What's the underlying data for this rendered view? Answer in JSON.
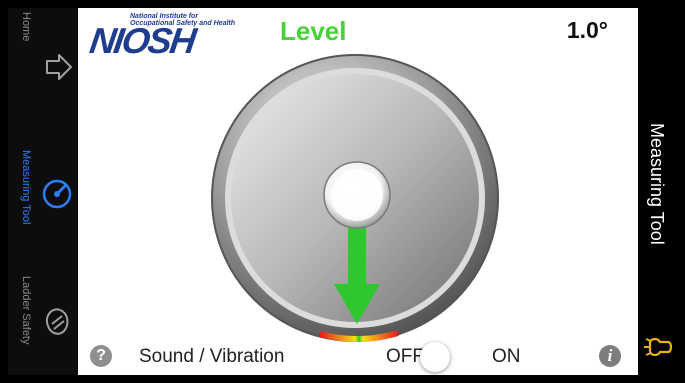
{
  "tabs": [
    {
      "label": "Home",
      "icon": "home-arrow-icon",
      "active": false
    },
    {
      "label": "Measuring Tool",
      "icon": "gauge-icon",
      "active": true
    },
    {
      "label": "Ladder Safety",
      "icon": "ladder-safety-icon",
      "active": false
    }
  ],
  "header": {
    "logo_text": "NIOSH",
    "logo_tagline": "National Institute for Occupational Safety and Health",
    "title": "Level",
    "angle": "1.0°"
  },
  "bottom": {
    "help_icon": "?",
    "sound_label": "Sound / Vibration",
    "off_label": "OFF",
    "on_label": "ON",
    "info_icon": "i",
    "switch_on": false
  },
  "side": {
    "title": "Measuring Tool",
    "bulb_icon": "light-bulb-icon"
  },
  "colors": {
    "accent": "#49d13c",
    "active_tab": "#2d7df6",
    "brand": "#1f3d8f"
  }
}
